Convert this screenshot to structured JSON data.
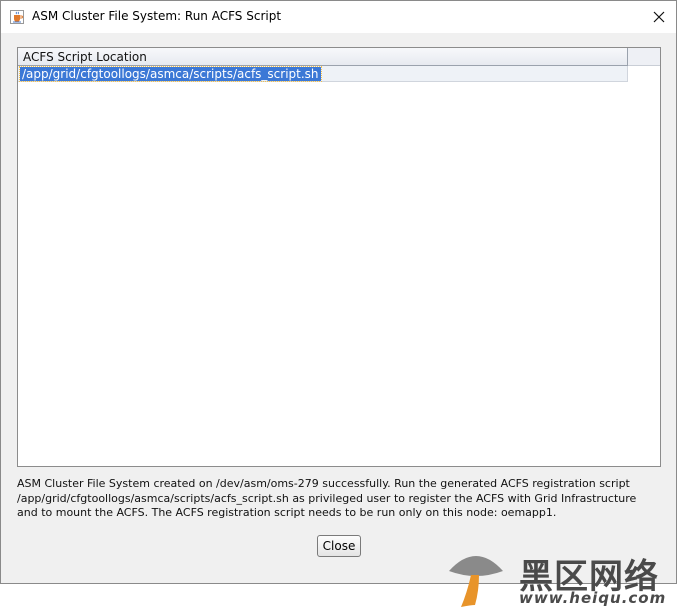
{
  "window": {
    "title": "ASM Cluster File System: Run ACFS Script",
    "app_icon": "java-cup-icon",
    "close_icon": "close-icon"
  },
  "table": {
    "columns": [
      "ACFS Script Location"
    ],
    "rows": [
      {
        "location": "/app/grid/cfgtoollogs/asmca/scripts/acfs_script.sh",
        "selected": true
      }
    ]
  },
  "message": {
    "lines": [
      "ASM Cluster File System created on /dev/asm/oms-279 successfully. Run the generated ACFS registration script",
      "/app/grid/cfgtoollogs/asmca/scripts/acfs_script.sh as privileged user to register the ACFS with Grid Infrastructure",
      "and to mount the ACFS. The ACFS registration script needs to be run only on this node: oemapp1."
    ]
  },
  "buttons": {
    "close_label": "Close"
  },
  "watermark": {
    "text": "黑区网络",
    "url": "www.heiqu.com"
  },
  "colors": {
    "selection": "#3b78d6",
    "dialog_bg": "#f0f0f0"
  }
}
